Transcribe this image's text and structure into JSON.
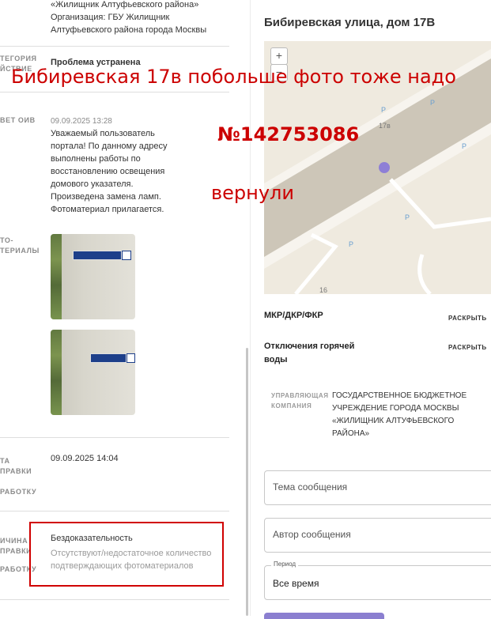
{
  "left": {
    "top_lines": [
      "«Жилищник Алтуфьевского района»",
      "Организация: ГБУ Жилищник",
      "Алтуфьевского района города Москвы"
    ],
    "category_label": [
      "ТЕГОРИЯ",
      "ЙСТВИЕ"
    ],
    "category_value": "Проблема устранена",
    "answer_label": "ВЕТ ОИВ",
    "answer_date": "09.09.2025 13:28",
    "answer_lines": [
      "Уважаемый пользователь",
      "портала! По данному адресу",
      "выполнены работы по",
      "восстановлению освещения",
      "домового указателя.",
      "Произведена замена ламп.",
      "Фотоматериал прилагается."
    ],
    "photo_label": [
      "ТО-",
      "ТЕРИАЛЫ"
    ],
    "sent_label": [
      "ТА",
      "ПРАВКИ",
      "РАБОТКУ"
    ],
    "sent_value": "09.09.2025 14:04",
    "reason_label": [
      "ИЧИНА",
      "ПРАВКИ",
      "РАБОТКУ"
    ],
    "reason_title": "Бездоказательность",
    "reason_desc": [
      "Отсутствуют/недостаточное количество",
      "подтверждающих фотоматериалов"
    ]
  },
  "right": {
    "address_title": "Бибиревская улица, дом 17В",
    "map": {
      "zoom_in": "+",
      "zoom_out": "−",
      "house_label": "17в",
      "parking": "P",
      "house_num_2": "16"
    },
    "mkr_label": "МКР/ДКР/ФКР",
    "expand_label": "РАСКРЫТЬ",
    "hot_water_label": [
      "Отключения горячей",
      "воды"
    ],
    "uk_label": [
      "УПРАВЛЯЮЩАЯ",
      "КОМПАНИЯ"
    ],
    "uk_value": [
      "ГОСУДАРСТВЕННОЕ БЮДЖЕТНОЕ",
      "УЧРЕЖДЕНИЕ ГОРОДА МОСКВЫ",
      "«ЖИЛИЩНИК АЛТУФЬЕВСКОГО",
      "РАЙОНА»"
    ],
    "topic_placeholder": "Тема сообщения",
    "author_placeholder": "Автор сообщения",
    "period_legend": "Период",
    "period_value": "Все время"
  },
  "annotations": {
    "line1": "Бибиревская 17в побольше фото тоже надо",
    "line2": "№142753086",
    "line3": "вернули"
  },
  "colors": {
    "annotation": "#cc0000",
    "accent": "#8b7fd0",
    "marker": "#8e7fd6"
  }
}
